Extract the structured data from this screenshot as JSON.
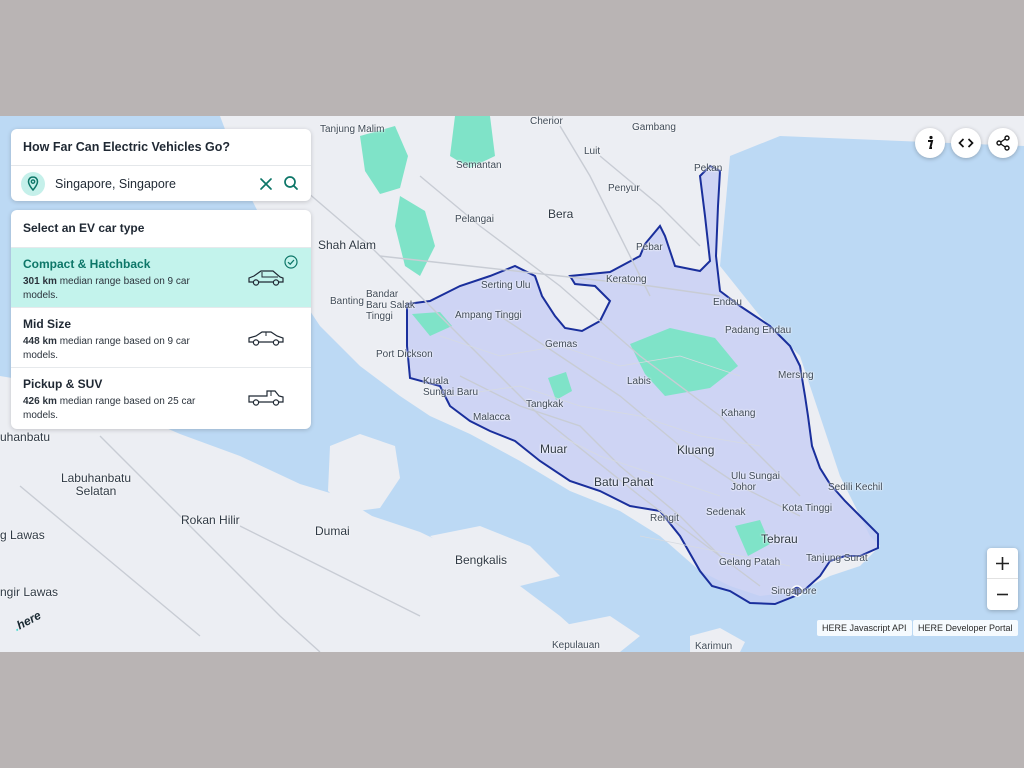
{
  "app": {
    "title": "How Far Can Electric Vehicles Go?"
  },
  "search": {
    "value": "Singapore, Singapore",
    "placeholder": "",
    "pin_icon": "location-pin-icon",
    "clear_icon": "close-icon",
    "search_icon": "search-icon"
  },
  "ev_panel": {
    "heading": "Select an EV car type",
    "options": [
      {
        "name": "Compact & Hatchback",
        "range": "301 km",
        "desc": " median range based on 9 car models.",
        "icon": "hatchback-car-icon",
        "selected": true
      },
      {
        "name": "Mid Size",
        "range": "448 km",
        "desc": " median range based on 9 car models.",
        "icon": "sedan-car-icon",
        "selected": false
      },
      {
        "name": "Pickup & SUV",
        "range": "426 km",
        "desc": " median range based on 25 car models.",
        "icon": "pickup-truck-icon",
        "selected": false
      }
    ]
  },
  "toolbar": {
    "info_icon": "info-icon",
    "code_icon": "code-icon",
    "share_icon": "share-icon"
  },
  "zoom": {
    "in_icon": "plus-icon",
    "out_icon": "minus-icon"
  },
  "footer": {
    "api_link": "HERE Javascript API",
    "portal_link": "HERE Developer Portal",
    "logo_text": "here"
  },
  "map_labels": [
    "Tanjung Malim",
    "Cherior",
    "Gambang",
    "Semantan",
    "Luit",
    "Penyur",
    "Pekan",
    "Pelangai",
    "Bera",
    "Shah Alam",
    "Pebar",
    "Serting Ulu",
    "Keratong",
    "Banting",
    "Bandar Baru Salak Tinggi",
    "Ampang Tinggi",
    "Endau",
    "Padang Endau",
    "Gemas",
    "Port Dickson",
    "Labis",
    "Mersing",
    "Kuala Sungai Baru",
    "Tangkak",
    "Malacca",
    "Kahang",
    "uhanbatu",
    "Muar",
    "Kluang",
    "Labuhanbatu Selatan",
    "Ulu Sungai Johor",
    "Batu Pahat",
    "Sedili Kechil",
    "Sedenak",
    "Kota Tinggi",
    "Rokan Hilir",
    "Rengit",
    "Dumai",
    "Tebrau",
    "g Lawas",
    "Tanjung Surat",
    "Gelang Patah",
    "Bengkalis",
    "Singapore",
    "ngir Lawas",
    "Kepulauan",
    "Karimun"
  ],
  "colors": {
    "accent": "#0d7668",
    "selected_bg": "#c3f3ec",
    "isoline": "#1a2f9c",
    "water": "#bcd9f4",
    "land": "#eceef3",
    "park": "#7fe3c8"
  }
}
